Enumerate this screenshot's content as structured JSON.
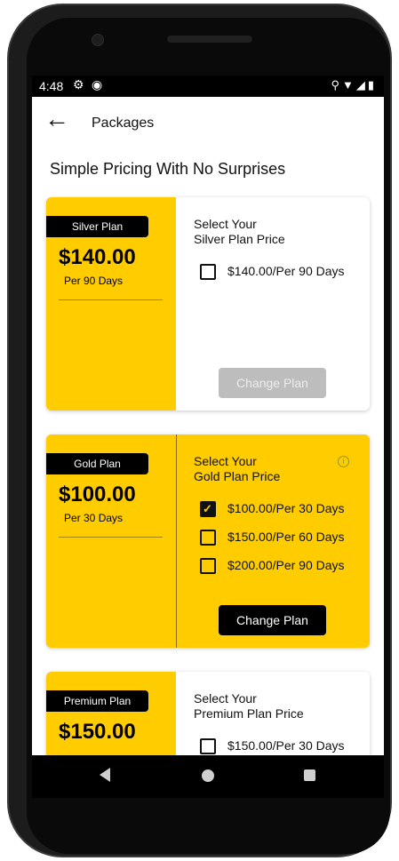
{
  "status_bar": {
    "time": "4:48",
    "icons": [
      "gear-icon",
      "at-circle-icon",
      "location-icon",
      "wifi-icon",
      "signal-icon",
      "battery-icon"
    ]
  },
  "app_bar": {
    "back_icon": "arrow-left-icon",
    "title": "Packages"
  },
  "page_heading": "Simple Pricing With No Surprises",
  "plans": [
    {
      "tag": "Silver Plan",
      "price": "$140.00",
      "period": "Per 90 Days",
      "select_line1": "Select Your",
      "select_line2": "Silver Plan Price",
      "options": [
        {
          "label": "$140.00/Per 90 Days",
          "checked": false
        }
      ],
      "button": "Change Plan",
      "button_enabled": false
    },
    {
      "tag": "Gold Plan",
      "price": "$100.00",
      "period": "Per 30 Days",
      "select_line1": "Select Your",
      "select_line2": "Gold Plan Price",
      "info_icon": "info-icon",
      "options": [
        {
          "label": "$100.00/Per 30 Days",
          "checked": true
        },
        {
          "label": "$150.00/Per 60 Days",
          "checked": false
        },
        {
          "label": "$200.00/Per 90 Days",
          "checked": false
        }
      ],
      "button": "Change Plan",
      "button_enabled": true
    },
    {
      "tag": "Premium Plan",
      "price": "$150.00",
      "select_line1": "Select Your",
      "select_line2": "Premium Plan Price",
      "options": [
        {
          "label": "$150.00/Per 30 Days",
          "checked": false
        }
      ]
    }
  ],
  "colors": {
    "accent": "#ffcc00",
    "dark": "#000000",
    "disabled_button": "#bdbdbd"
  },
  "nav_bar": {
    "icons": [
      "nav-back-icon",
      "nav-home-icon",
      "nav-recents-icon"
    ]
  }
}
